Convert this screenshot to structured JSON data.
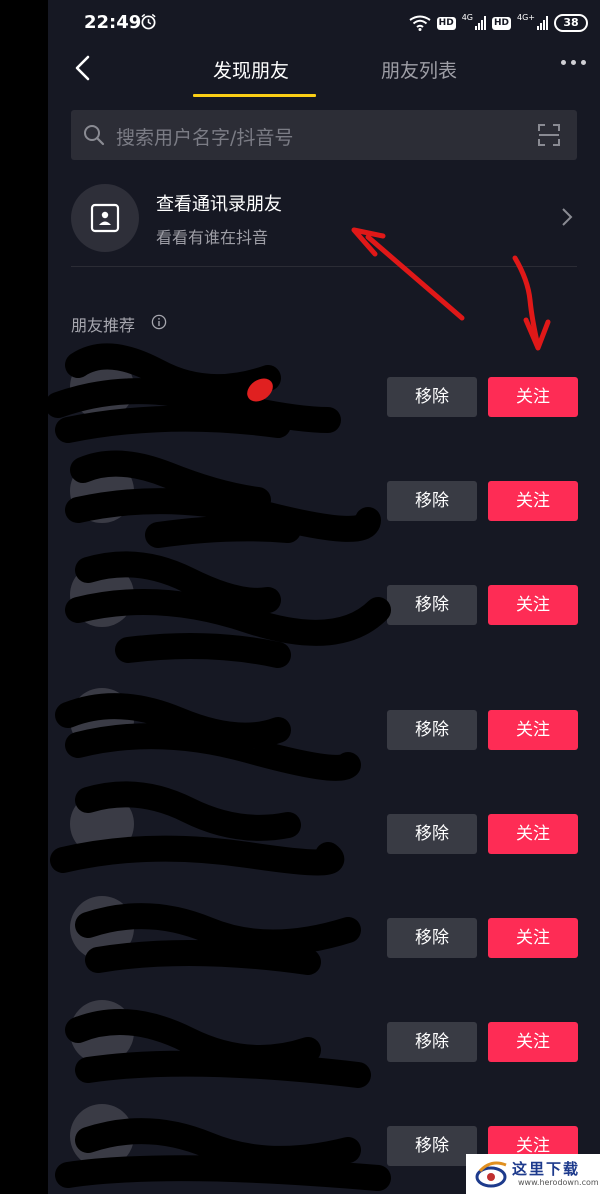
{
  "status_bar": {
    "time": "22:49",
    "hd1": "HD",
    "net1": "4G",
    "hd2": "HD",
    "net2": "4G+",
    "battery": "38"
  },
  "header": {
    "tab_active": "发现朋友",
    "tab_inactive": "朋友列表",
    "accent_color": "#face15"
  },
  "search": {
    "placeholder": "搜索用户名字/抖音号"
  },
  "contacts_card": {
    "title": "查看通讯录朋友",
    "subtitle": "看看有谁在抖音"
  },
  "recommend": {
    "section_title": "朋友推荐",
    "remove_label": "移除",
    "follow_label": "关注",
    "follow_color": "#fe2c55",
    "rows": [
      {
        "name": ""
      },
      {
        "name": ""
      },
      {
        "name": ""
      },
      {
        "name": ""
      },
      {
        "name": ""
      },
      {
        "name": ""
      },
      {
        "name": ""
      },
      {
        "name": ""
      }
    ]
  },
  "watermark": {
    "title": "这里下载",
    "url": "www.herodown.com"
  }
}
